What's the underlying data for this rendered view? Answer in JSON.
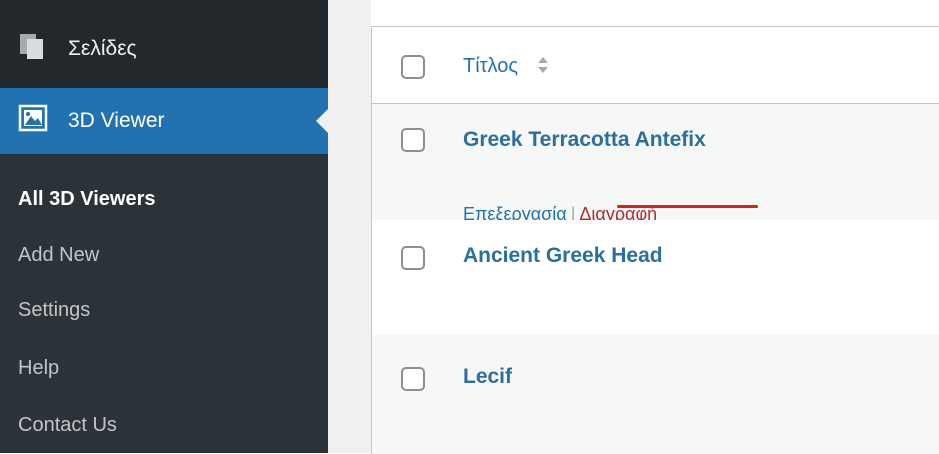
{
  "sidebar": {
    "pages_label": "Σελίδες",
    "current_label": "3D Viewer",
    "submenu": [
      "All 3D Viewers",
      "Add New",
      "Settings",
      "Help",
      "Contact Us"
    ]
  },
  "table": {
    "column_title": "Τίτλος",
    "rows": [
      {
        "title": "Greek Terracotta Antefix",
        "edit": "Επεξεργασία",
        "separator": "|",
        "delete": "Διαγραφή"
      },
      {
        "title": "Ancient Greek Head"
      },
      {
        "title": "Lecif"
      }
    ]
  },
  "colors": {
    "sidebar_bg": "#23282d",
    "submenu_bg": "#2c3338",
    "accent": "#2271b1",
    "delete": "#b32d2e",
    "annotation": "#d62020"
  }
}
